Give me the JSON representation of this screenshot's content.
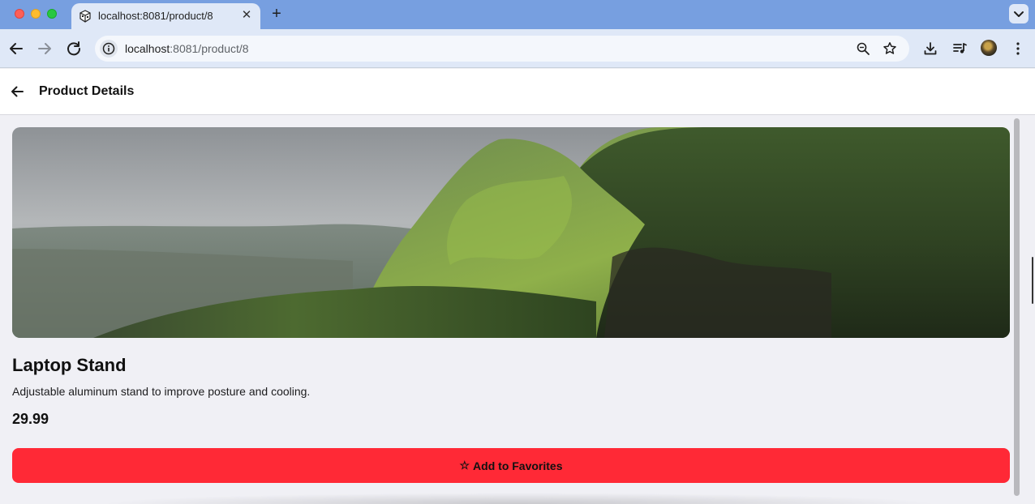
{
  "browser": {
    "tab": {
      "title": "localhost:8081/product/8",
      "close_label": "✕"
    },
    "new_tab_label": "+",
    "address": {
      "host": "localhost",
      "path": ":8081/product/8"
    }
  },
  "header": {
    "title": "Product Details"
  },
  "product": {
    "name": "Laptop Stand",
    "description": "Adjustable aluminum stand to improve posture and cooling.",
    "price": "29.99",
    "favorite_button": {
      "icon": "☆",
      "label": "Add to Favorites"
    }
  },
  "colors": {
    "tabbar": "#779fe0",
    "toolbar": "#dfe8f7",
    "page_bg": "#f0f0f5",
    "accent_button": "#ff2936"
  }
}
